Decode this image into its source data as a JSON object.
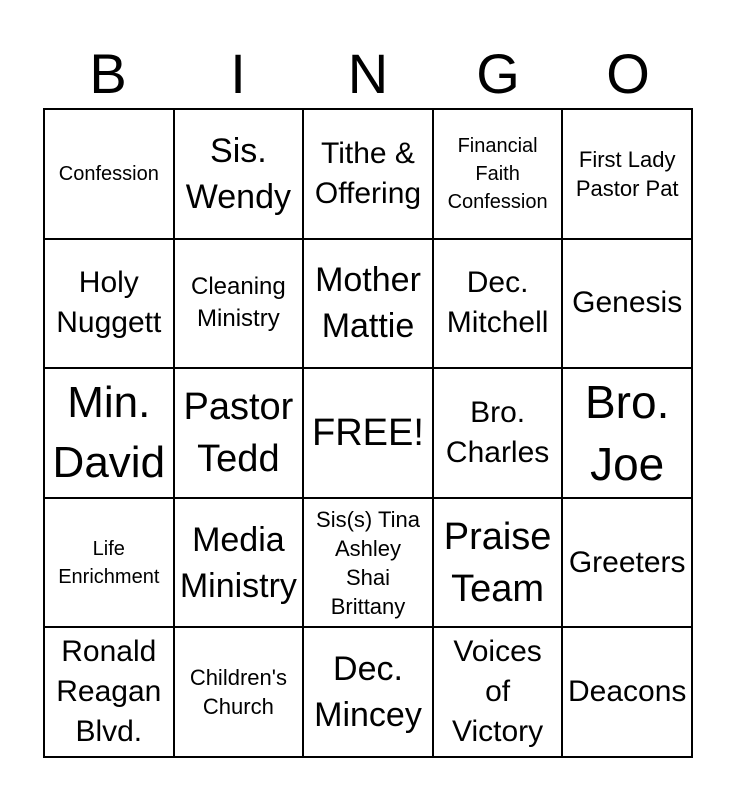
{
  "header": [
    "B",
    "I",
    "N",
    "G",
    "O"
  ],
  "cells": [
    [
      "Confession",
      "Sis.\nWendy",
      "Tithe &\nOffering",
      "Financial\nFaith\nConfession",
      "First Lady\nPastor Pat"
    ],
    [
      "Holy\nNuggett",
      "Cleaning\nMinistry",
      "Mother\nMattie",
      "Dec.\nMitchell",
      "Genesis"
    ],
    [
      "Min.\nDavid",
      "Pastor\nTedd",
      "FREE!",
      "Bro.\nCharles",
      "Bro.\nJoe"
    ],
    [
      "Life\nEnrichment",
      "Media\nMinistry",
      "Sis(s) Tina\nAshley\nShai\nBrittany",
      "Praise\nTeam",
      "Greeters"
    ],
    [
      "Ronald\nReagan\nBlvd.",
      "Children's\nChurch",
      "Dec.\nMincey",
      "Voices\nof\nVictory",
      "Deacons"
    ]
  ]
}
